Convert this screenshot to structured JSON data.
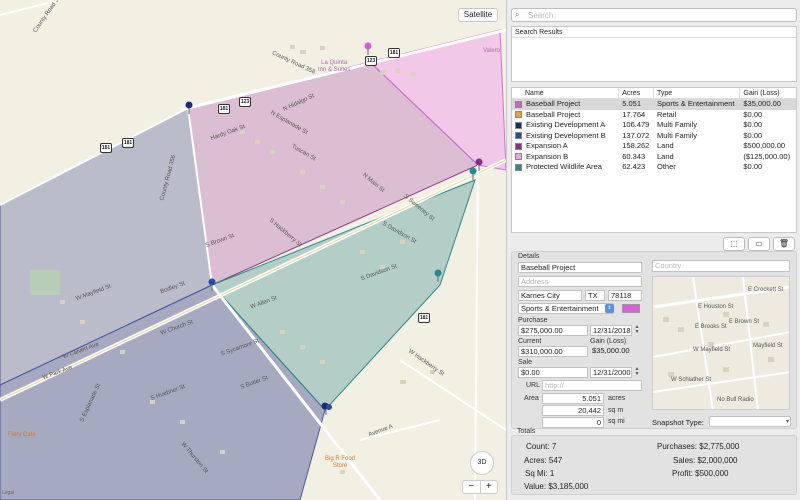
{
  "map": {
    "satellite_label": "Satellite",
    "btn_3d": "3D",
    "zoom_out": "−",
    "zoom_in": "+",
    "legal": "Legal",
    "poi_la_quinta": "La Quinta\nInn & Suites",
    "poi_valero": "Valero",
    "poi_big_food": "Big R Food\nStore",
    "poi_fiery_cafe": "Fiery Cafe",
    "shields": [
      "181",
      "123",
      "181",
      "123",
      "181",
      "181",
      "181"
    ],
    "streets": [
      "County Road 326",
      "County Road 358",
      "County Road 356",
      "Hardy Oak St",
      "N Hidalgo St",
      "N Esplanade St",
      "Tuscan St",
      "N Main St",
      "S Sweeney St",
      "S Davidson St",
      "S Brown St",
      "S Davidson St",
      "S Hackberry St",
      "W Hackberry St",
      "Avenue A",
      "S Sycamore St",
      "S Butler St",
      "W Calvert Ave",
      "S Huebner St",
      "W Church St",
      "S Esplanade St",
      "W Park Ave",
      "W Thurston St",
      "W Mayfield St",
      "Bodley St",
      "W Allen St"
    ]
  },
  "search": {
    "placeholder": "Search"
  },
  "results": {
    "header": "Search Results"
  },
  "table": {
    "headers": {
      "name": "Name",
      "acres": "Acres",
      "type": "Type",
      "gain": "Gain (Loss)"
    },
    "rows": [
      {
        "name": "Baseball Project",
        "acres": "5.051",
        "type": "Sports & Entertainment",
        "gain": "$35,000.00",
        "color": "#d659d6"
      },
      {
        "name": "Baseball Project",
        "acres": "17.764",
        "type": "Retail",
        "gain": "$0.00",
        "color": "#f0a030"
      },
      {
        "name": "Existing Development A",
        "acres": "106.479",
        "type": "Multi Family",
        "gain": "$0.00",
        "color": "#1a2a7a"
      },
      {
        "name": "Existing Development B",
        "acres": "137.072",
        "type": "Multi Family",
        "gain": "$0.00",
        "color": "#2a4a9a"
      },
      {
        "name": "Expansion A",
        "acres": "158.262",
        "type": "Land",
        "gain": "$500,000.00",
        "color": "#8a2a8a"
      },
      {
        "name": "Expansion B",
        "acres": "60.343",
        "type": "Land",
        "gain": "($125,000.00)",
        "color": "#f0a0e6"
      },
      {
        "name": "Protected Wildlife Area",
        "acres": "62.423",
        "type": "Other",
        "gain": "$0.00",
        "color": "#2a8a8a"
      }
    ]
  },
  "details": {
    "section": "Details",
    "name": "Baseball Project",
    "address_placeholder": "Address",
    "city": "Karnes City",
    "state": "TX",
    "zip": "78118",
    "country_placeholder": "Country",
    "type": "Sports & Entertainment",
    "purchase_label": "Purchase",
    "purchase_value": "$275,000.00",
    "purchase_date": "12/31/2018",
    "current_label": "Current",
    "current_value": "$310,000.00",
    "gain_label": "Gain (Loss)",
    "gain_value": "$35,000.00",
    "sale_label": "Sale",
    "sale_value": "$0.00",
    "sale_date": "12/31/2000",
    "url_label": "URL",
    "url_placeholder": "http://",
    "area_label": "Area",
    "area_acres": "5.051",
    "area_acres_unit": "acres",
    "area_sqm": "20,442",
    "area_sqm_unit": "sq m",
    "area_sqmi": "0",
    "area_sqmi_unit": "sq mi",
    "snapshot_type_label": "Snapshot Type:",
    "snap_streets": [
      "E Houston St",
      "E Crockett St",
      "E Brown St",
      "E Brooks St",
      "W Mayfield St",
      "Mayfield St",
      "W Schlather St",
      "No Bull Radio"
    ]
  },
  "totals": {
    "section": "Totals",
    "count_label": "Count:",
    "count": "7",
    "acres_label": "Acres:",
    "acres": "547",
    "sqmi_label": "Sq Mi:",
    "sqmi": "1",
    "value_label": "Value:",
    "value": "$3,185,000",
    "purchases_label": "Purchases:",
    "purchases": "$2,775,000",
    "sales_label": "Sales:",
    "sales": "$2,000,000",
    "profit_label": "Profit:",
    "profit": "$500,000"
  }
}
